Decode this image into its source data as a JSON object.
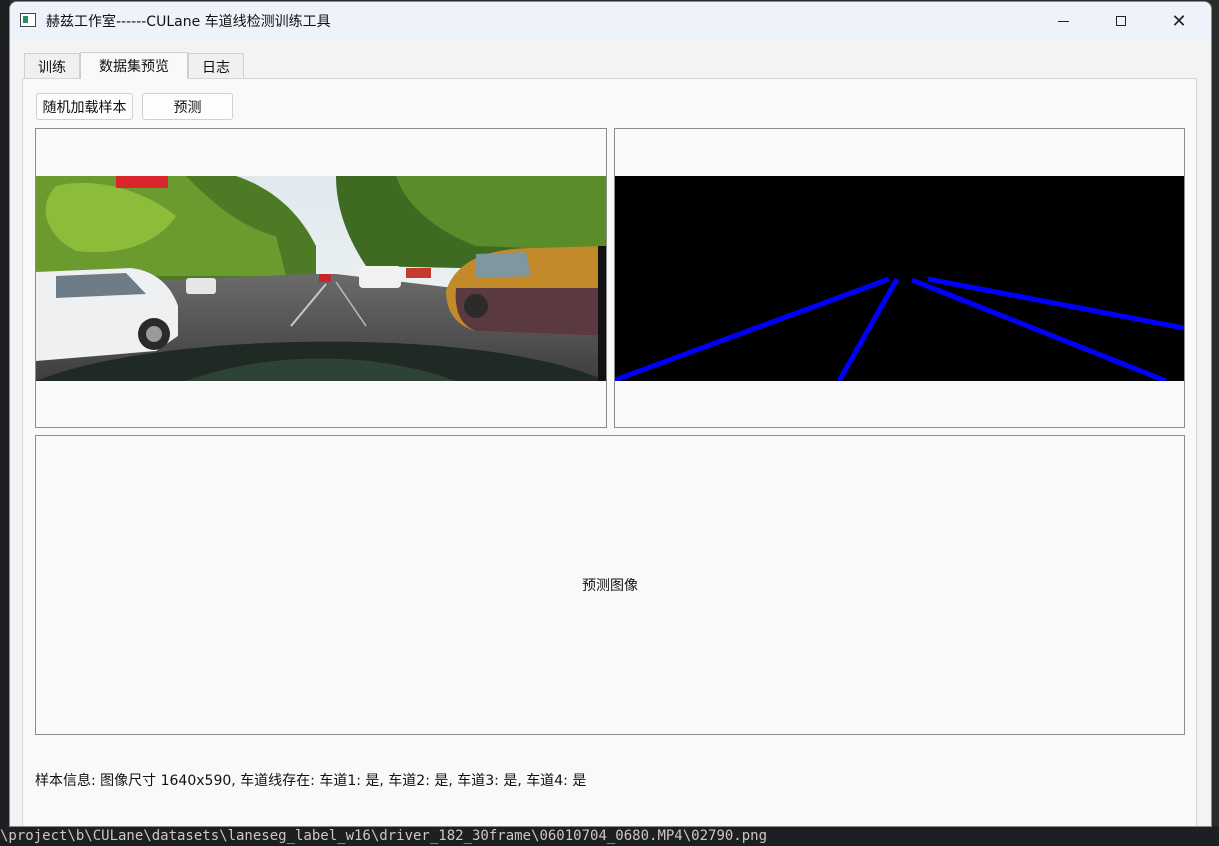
{
  "window": {
    "title": "赫兹工作室------CULane 车道线检测训练工具",
    "app_icon": "app-window-icon",
    "controls": {
      "minimize": "minimize-icon",
      "maximize": "maximize-icon",
      "close": "close-icon",
      "close_glyph": "✕"
    }
  },
  "tabs": [
    {
      "label": "训练",
      "active": false
    },
    {
      "label": "数据集预览",
      "active": true
    },
    {
      "label": "日志",
      "active": false
    }
  ],
  "toolbar": {
    "load_sample_label": "随机加载样本",
    "predict_label": "预测"
  },
  "views": {
    "original_image": "road-camera-image",
    "label_image": "lane-label-mask",
    "prediction_placeholder": "预测图像",
    "lane_color": "#0000ff"
  },
  "sample_info": "样本信息: 图像尺寸 1640x590, 车道线存在: 车道1: 是, 车道2: 是, 车道3: 是, 车道4: 是",
  "background": {
    "path_text": "\\project\\b\\CULane\\datasets\\laneseg_label_w16\\driver_182_30frame\\06010704_0680.MP4\\02790.png"
  }
}
